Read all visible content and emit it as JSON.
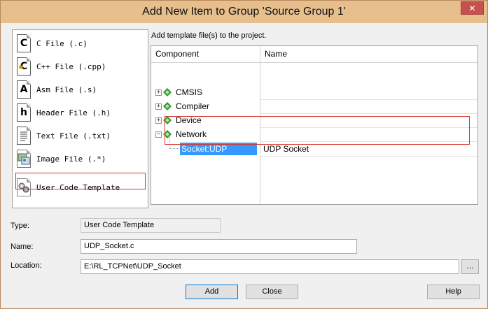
{
  "window": {
    "title": "Add New Item to Group 'Source Group 1'",
    "close_glyph": "✕"
  },
  "file_types": [
    {
      "icon": "c-file-icon",
      "glyph": "C",
      "label": "C File (.c)"
    },
    {
      "icon": "cpp-file-icon",
      "glyph": "C",
      "label": "C++ File (.cpp)"
    },
    {
      "icon": "asm-file-icon",
      "glyph": "A",
      "label": "Asm File (.s)"
    },
    {
      "icon": "header-file-icon",
      "glyph": "h",
      "label": "Header File (.h)"
    },
    {
      "icon": "text-file-icon",
      "glyph": "",
      "label": "Text File (.txt)"
    },
    {
      "icon": "image-file-icon",
      "glyph": "",
      "label": "Image File (.*)"
    },
    {
      "icon": "user-code-template-icon",
      "glyph": "",
      "label": "User Code Template"
    }
  ],
  "selected_type_index": 6,
  "hint": "Add template file(s) to the project.",
  "tree": {
    "col_component": "Component",
    "col_name": "Name",
    "nodes": [
      {
        "label": "CMSIS",
        "expander": "+"
      },
      {
        "label": "Compiler",
        "expander": "+"
      },
      {
        "label": "Device",
        "expander": "+"
      },
      {
        "label": "Network",
        "expander": "−"
      }
    ],
    "child": {
      "component": "Socket:UDP",
      "name": "UDP Socket"
    }
  },
  "form": {
    "type_label": "Type:",
    "type_value": "User Code Template",
    "name_label": "Name:",
    "name_value": "UDP_Socket.c",
    "location_label": "Location:",
    "location_value": "E:\\RL_TCPNet\\UDP_Socket",
    "browse_label": "..."
  },
  "buttons": {
    "add": "Add",
    "close": "Close",
    "help": "Help"
  },
  "colors": {
    "titlebar": "#e7bf8c",
    "selection": "#3399ff",
    "highlight_box": "#d9342b",
    "tree_diamond": "#2e9a2e"
  }
}
